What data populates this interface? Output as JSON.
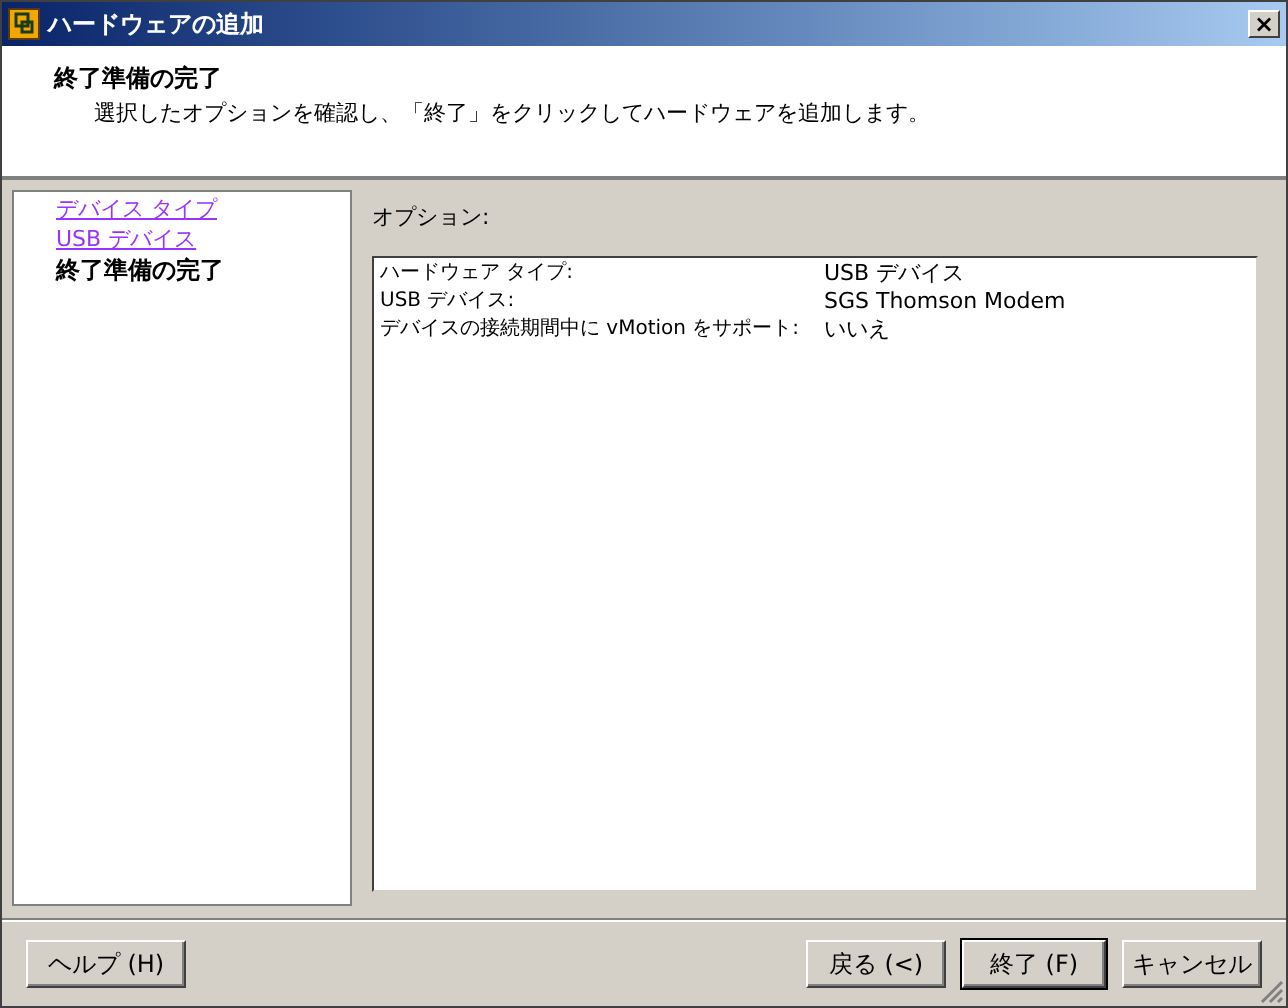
{
  "window": {
    "title": "ハードウェアの追加",
    "close": "×"
  },
  "header": {
    "title": "終了準備の完了",
    "subtitle": "選択したオプションを確認し、「終了」をクリックしてハードウェアを追加します。"
  },
  "steps": [
    {
      "label": "デバイス タイプ",
      "selected": false
    },
    {
      "label": "USB デバイス",
      "selected": false
    },
    {
      "label": "終了準備の完了",
      "selected": true
    }
  ],
  "options": {
    "label": "オプション:",
    "rows": [
      {
        "name": "ハードウェア タイプ:",
        "value": "USB デバイス"
      },
      {
        "name": "USB デバイス:",
        "value": "SGS Thomson Modem"
      },
      {
        "name": "デバイスの接続期間中に vMotion をサポート:",
        "value": "いいえ"
      }
    ]
  },
  "buttons": {
    "help": "ヘルプ (H)",
    "back": "戻る (<)",
    "finish": "終了 (F)",
    "cancel": "キャンセル"
  }
}
